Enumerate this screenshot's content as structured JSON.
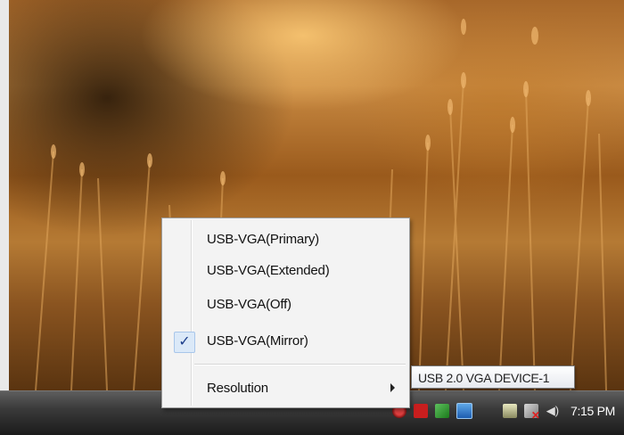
{
  "context_menu": {
    "items": [
      {
        "label": "USB-VGA(Primary)",
        "checked": false
      },
      {
        "label": "USB-VGA(Extended)",
        "checked": false
      },
      {
        "label": "USB-VGA(Off)",
        "checked": false
      },
      {
        "label": "USB-VGA(Mirror)",
        "checked": true
      }
    ],
    "submenu": {
      "label": "Resolution"
    },
    "check_glyph": "✓"
  },
  "tooltip": {
    "text": "USB 2.0 VGA DEVICE-1"
  },
  "taskbar": {
    "clock": "7:15 PM",
    "tray_icons": [
      "shield-warning-icon",
      "pdf-icon",
      "antivirus-icon",
      "usb-vga-icon",
      "safely-remove-icon",
      "network-disconnected-icon",
      "volume-icon"
    ]
  },
  "colors": {
    "menu_bg": "#f3f3f3",
    "check_highlight": "#dbe9f8",
    "taskbar": "#2a2a2a"
  }
}
